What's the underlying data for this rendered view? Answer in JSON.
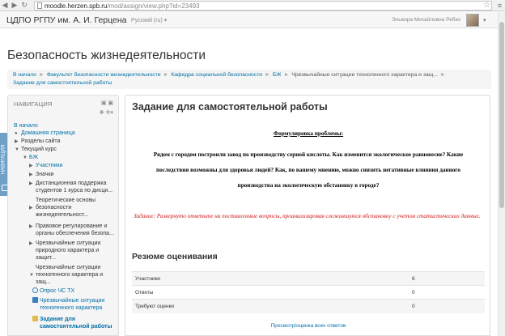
{
  "browser": {
    "url_host": "moodle.herzen.spb.ru",
    "url_path": "/mod/assign/view.php?id=23493"
  },
  "navbar": {
    "brand": "ЦДПО РГПУ им. А. И. Герцена",
    "language": "Русский (ru) ▾",
    "user_name": "Эльвира Михайловна Ребко"
  },
  "page": {
    "title": "Безопасность жизнедеятельности"
  },
  "breadcrumb": {
    "items": [
      "В начало",
      "Факультет безопасности жизнедеятельности",
      "Кафедра социальной безопасности",
      "БЖ",
      "Чрезвычайные ситуации техногенного характера и защ..."
    ],
    "last": "Задание для самостоятельной работы"
  },
  "dock": {
    "label": "НАВИГАЦИЯ"
  },
  "navigation": {
    "header": "НАВИГАЦИЯ",
    "controls": "▣ ▣",
    "controls2": "✥ ✲▾",
    "items": [
      "В начало",
      "Домашняя страница",
      "Разделы сайта",
      "Текущий курс",
      "БЖ",
      "Участники",
      "Значки",
      "Дистанционная поддержка",
      "студентов 1 курса по дисци...",
      "Теоретические основы",
      "безопасности",
      "жизнедеятельност...",
      "Правовое регулирование и",
      "органы обеспечения безопа...",
      "Чрезвычайные ситуации",
      "природного характера и",
      "защит...",
      "Чрезвычайные ситуации",
      "техногенного характера и",
      "защ...",
      "Опрос ЧС ТХ",
      "Чрезвычайные ситуации",
      "техногенного характера",
      "Задание для",
      "самостоятельной работы"
    ]
  },
  "assignment": {
    "title": "Задание для самостоятельной работы",
    "problem_heading": "Формулировка проблемы:",
    "problem_text": "Рядом с городом построили завод по производству серной кислоты. Как изменится экологическое равновесие? Какие последствия возможны для здоровья людей? Как, по вашему мнению, можно снизить негативные влияния данного производства на экологическую обстановку в городе?",
    "task_text": "Задание: Развернуто ответьте на поставленные вопросы, проанализировав сложившуюся обстановку с учетом статистических данных."
  },
  "grading_summary": {
    "title": "Резюме оценивания",
    "rows": [
      {
        "label": "Участники",
        "value": "6"
      },
      {
        "label": "Ответы",
        "value": "0"
      },
      {
        "label": "Требуют оценки",
        "value": "0"
      }
    ],
    "view_all": "Просмотр/оценка всех ответов"
  },
  "colors": {
    "link": "#0070a8",
    "task_red": "#d21414",
    "dock_blue": "#6ea0c8"
  }
}
